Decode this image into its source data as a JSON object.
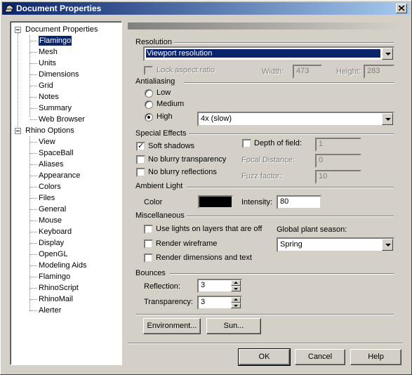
{
  "window": {
    "title": "Document Properties",
    "close_icon": "close-icon"
  },
  "tree": {
    "root1": "Document Properties",
    "root1_children": [
      "Flamingo",
      "Mesh",
      "Units",
      "Dimensions",
      "Grid",
      "Notes",
      "Summary",
      "Web Browser"
    ],
    "root2": "Rhino Options",
    "root2_children": [
      "View",
      "SpaceBall",
      "Aliases",
      "Appearance",
      "Colors",
      "Files",
      "General",
      "Mouse",
      "Keyboard",
      "Display",
      "OpenGL",
      "Modeling Aids",
      "Flamingo",
      "RhinoScript",
      "RhinoMail",
      "Alerter"
    ],
    "selected": "Flamingo"
  },
  "resolution": {
    "title": "Resolution",
    "value": "Viewport resolution",
    "lock_label": "Lock aspect ratio",
    "width_label": "Width:",
    "width_value": "473",
    "height_label": "Height:",
    "height_value": "283"
  },
  "antialiasing": {
    "title": "Antialiasing",
    "low": "Low",
    "medium": "Medium",
    "high": "High",
    "selected": "High",
    "level_value": "4x (slow)"
  },
  "special_effects": {
    "title": "Special Effects",
    "soft_shadows": "Soft shadows",
    "no_blurry_transparency": "No blurry transparency",
    "no_blurry_reflections": "No blurry reflections",
    "depth_of_field": "Depth of field:",
    "depth_value": "1",
    "focal_distance": "Focal Distance:",
    "focal_value": "0",
    "fuzz_factor": "Fuzz factor:",
    "fuzz_value": "10"
  },
  "ambient": {
    "title": "Ambient Light",
    "color_label": "Color",
    "color_value": "#000000",
    "intensity_label": "Intensity:",
    "intensity_value": "80"
  },
  "misc": {
    "title": "Miscellaneous",
    "use_lights": "Use lights on layers that are off",
    "render_wireframe": "Render wireframe",
    "render_dimensions": "Render dimensions and text",
    "season_label": "Global plant season:",
    "season_value": "Spring"
  },
  "bounces": {
    "title": "Bounces",
    "reflection_label": "Reflection:",
    "reflection_value": "3",
    "transparency_label": "Transparency:",
    "transparency_value": "3"
  },
  "buttons": {
    "environment": "Environment...",
    "sun": "Sun...",
    "ok": "OK",
    "cancel": "Cancel",
    "help": "Help"
  }
}
